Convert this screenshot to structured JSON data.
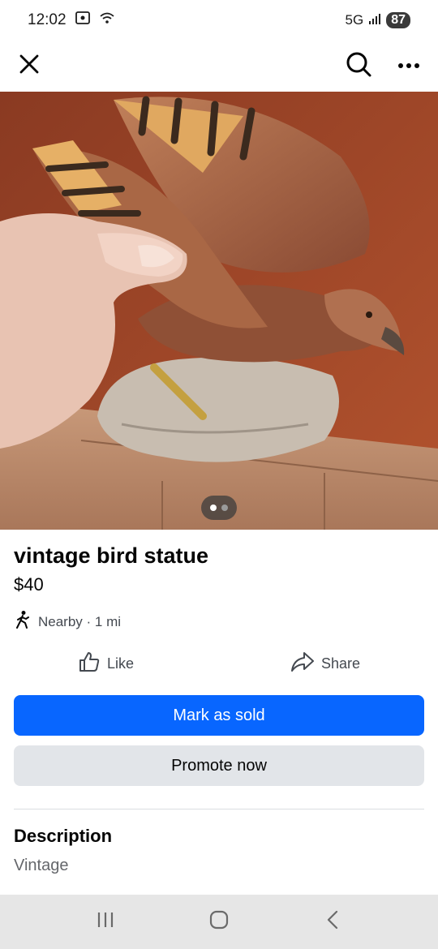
{
  "status": {
    "time": "12:02",
    "network": "5G",
    "battery": "87"
  },
  "photo": {
    "index": 1,
    "count": 2
  },
  "listing": {
    "title": "vintage bird statue",
    "price": "$40",
    "location": "Nearby · 1 mi"
  },
  "actions": {
    "like_label": "Like",
    "share_label": "Share"
  },
  "buttons": {
    "mark_sold": "Mark as sold",
    "promote": "Promote now"
  },
  "description": {
    "heading": "Description",
    "text": "Vintage"
  },
  "colors": {
    "primary": "#0866ff",
    "secondary_button": "#e2e5e9",
    "muted_text": "#65676b"
  }
}
